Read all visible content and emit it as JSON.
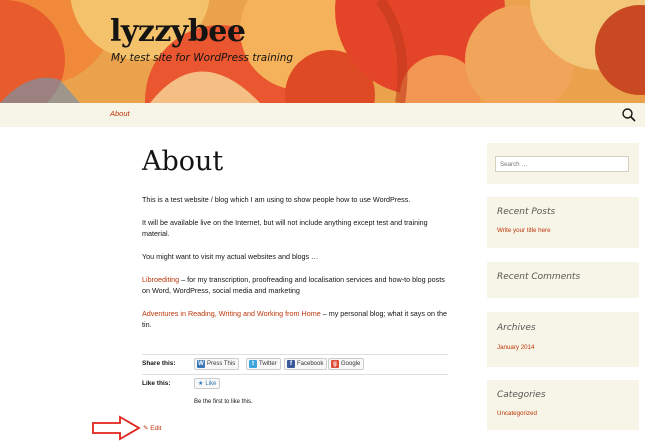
{
  "header": {
    "site_title": "lyzzybee",
    "site_description": "My test site for WordPress training"
  },
  "nav": {
    "items": [
      {
        "label": "About"
      }
    ],
    "search_icon": "search-icon"
  },
  "post": {
    "title": "About",
    "paragraphs": [
      "This is a test website / blog which I am using to show people how to use WordPress.",
      "It will be available live on the Internet, but will not include anything except test and training material.",
      "You might want to visit my actual websites and blogs …"
    ],
    "link1": {
      "text": "Libroediting",
      "rest": " – for my transcription, proofreading and localisation services and how-to blog posts on Word, WordPress, social media and marketing"
    },
    "link2": {
      "text": "Adventures in Reading, Writing and Working from Home",
      "rest": " – my personal blog; what it says on the tin."
    }
  },
  "share": {
    "share_label": "Share this:",
    "buttons": [
      "Press This",
      "Twitter",
      "Facebook",
      "Google"
    ],
    "like_label": "Like this:",
    "like_button": "Like",
    "like_first": "Be the first to like this."
  },
  "edit": {
    "label": "Edit"
  },
  "sidebar": {
    "search_placeholder": "Search …",
    "recent_posts_title": "Recent Posts",
    "recent_posts_items": [
      "Write your title here"
    ],
    "recent_comments_title": "Recent Comments",
    "archives_title": "Archives",
    "archives_items": [
      "January 2014"
    ],
    "categories_title": "Categories",
    "categories_items": [
      "Uncategorized"
    ]
  },
  "colors": {
    "accent": "#bc360a",
    "sidebar_bg": "#f7f5e7",
    "arrow": "#e0231a"
  }
}
